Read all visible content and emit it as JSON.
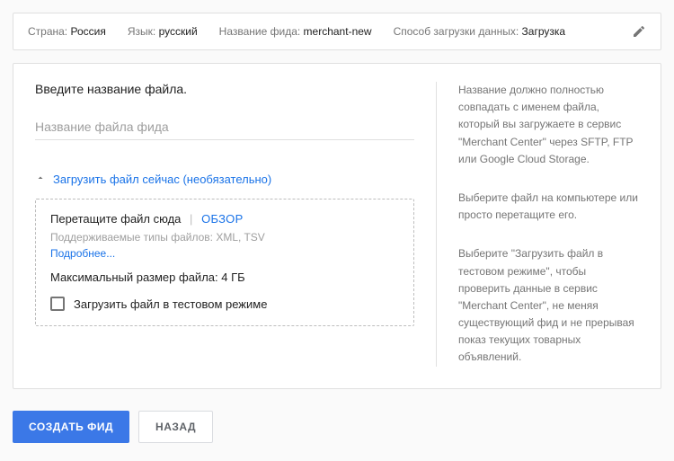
{
  "summary": {
    "country_label": "Страна:",
    "country_value": "Россия",
    "language_label": "Язык:",
    "language_value": "русский",
    "feedname_label": "Название фида:",
    "feedname_value": "merchant-new",
    "method_label": "Способ загрузки данных:",
    "method_value": "Загрузка"
  },
  "main": {
    "filename_heading": "Введите название файла.",
    "filename_placeholder": "Название файла фида",
    "filename_value": "",
    "expander_label": "Загрузить файл сейчас (необязательно)",
    "upload": {
      "drop_text": "Перетащите файл сюда",
      "sep": "|",
      "browse": "ОБЗОР",
      "supported": "Поддерживаемые типы файлов: XML, TSV",
      "more": "Подробнее...",
      "max_size": "Максимальный размер файла: 4 ГБ",
      "test_mode_label": "Загрузить файл в тестовом режиме",
      "test_mode_checked": false
    }
  },
  "help": {
    "filename": "Название должно полностью совпадать с именем файла, который вы загружаете в сервис \"Merchant Center\" через SFTP, FTP или Google Cloud Storage.",
    "upload_a": "Выберите файл на компьютере или просто перетащите его.",
    "upload_b": "Выберите \"Загрузить файл в тестовом режиме\", чтобы проверить данные в сервис \"Merchant Center\", не меняя существующий фид и не прерывая показ текущих товарных объявлений."
  },
  "footer": {
    "create": "Создать фид",
    "back": "Назад"
  }
}
